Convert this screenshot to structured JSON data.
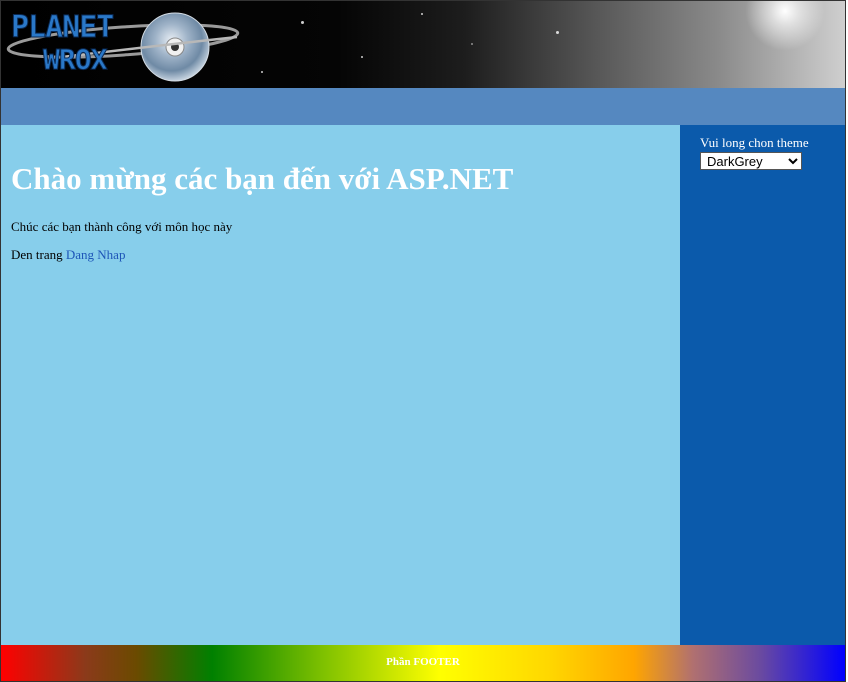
{
  "header": {
    "logo_text_line1": "PLANET",
    "logo_text_line2": "WROX"
  },
  "main": {
    "heading": "Chào mừng các bạn đến với ASP.NET",
    "intro_text": "Chúc các bạn thành công với môn học này",
    "nav_prefix": "Den trang ",
    "nav_link_label": "Dang Nhap"
  },
  "sidebar": {
    "theme_label": "Vui long chon theme",
    "theme_selected": "DarkGrey"
  },
  "footer": {
    "text": "Phần FOOTER"
  },
  "colors": {
    "menubar": "#5588c0",
    "main_bg": "#87ceeb",
    "sidebar_bg": "#0b5aab",
    "link": "#1e56b8"
  }
}
